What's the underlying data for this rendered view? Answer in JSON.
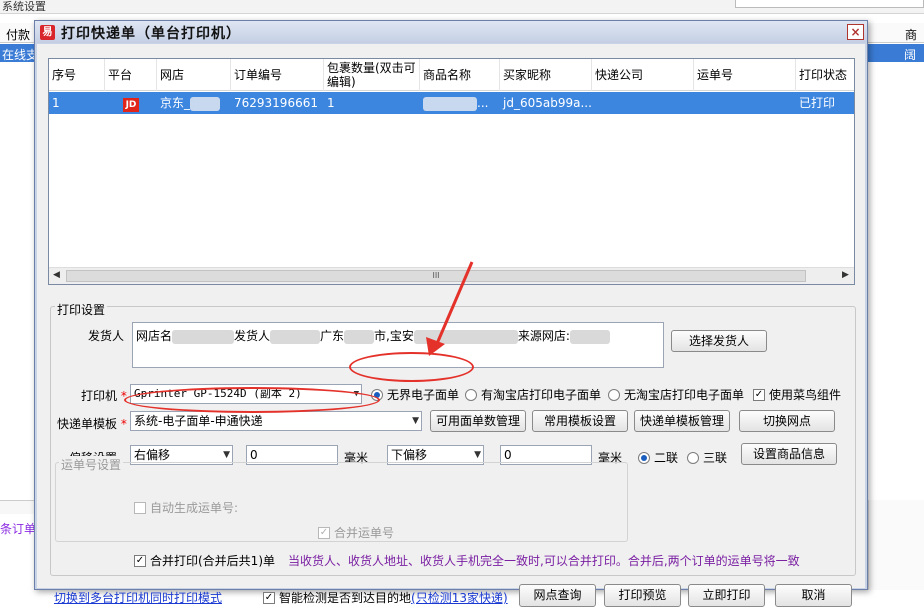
{
  "background": {
    "menu_label": "系统设置",
    "header_left": "付款",
    "header_right": "商",
    "row_left": "在线支",
    "row_right": "阔签",
    "bottom_left_text": "条订单"
  },
  "dialog": {
    "icon_glyph": "易",
    "title": "打印快递单（单台打印机）",
    "close_label": "×"
  },
  "grid": {
    "columns": [
      "序号",
      "平台",
      "网店",
      "订单编号",
      "包裹数量(双击可编辑)",
      "商品名称",
      "买家昵称",
      "快递公司",
      "运单号",
      "打印状态"
    ],
    "row": {
      "index": "1",
      "platform": "JD",
      "shop": "京东_",
      "order_no": "76293196661",
      "packages": "1",
      "product": "...",
      "buyer": "jd_605ab99a...",
      "express": "",
      "waybill": "",
      "status": "已打印"
    },
    "scroll_grip": "III"
  },
  "settings": {
    "group_label": "打印设置",
    "sender_label": "发货人",
    "sender_text": {
      "p1": "网店名",
      "p2": "发货人",
      "p3": "广东",
      "p4": "市,宝安",
      "p5": "来源网店:"
    },
    "select_sender_button": "选择发货人",
    "printer_label": "打印机",
    "required_mark": "*",
    "printer_value": "Gprinter  GP-1524D (副本 2)",
    "radio_options": [
      "无界电子面单",
      "有淘宝店打印电子面单",
      "无淘宝店打印电子面单"
    ],
    "radio_selected": 0,
    "use_cainiao_label": "使用菜鸟组件",
    "use_cainiao_checked": true,
    "template_label": "快递单模板",
    "template_value": "系统-电子面单-申通快递",
    "buttons_row2": [
      "可用面单数管理",
      "常用模板设置",
      "快递单模板管理",
      "切换网点"
    ],
    "offset_label": "偏移设置",
    "offset_h_dir": "右偏移",
    "offset_h_value": "0",
    "offset_h_unit": "毫米",
    "offset_v_dir": "下偏移",
    "offset_v_value": "0",
    "offset_v_unit": "毫米",
    "copies_options": [
      "二联",
      "三联"
    ],
    "copies_selected": 0,
    "set_product_info_button": "设置商品信息",
    "waybill_group_label": "运单号设置",
    "auto_waybill_label": "自动生成运单号:",
    "merge_waybill_label": "合并运单号",
    "merge_print_label": "合并打印(合并后共1)单",
    "merge_hint": "当收货人、收货人地址、收货人手机完全一致时,可以合并打印。合并后,两个订单的运单号将一致"
  },
  "footer": {
    "switch_link": "切换到多台打印机同时打印模式",
    "smart_check_label": "智能检测是否到达目的地",
    "smart_check_link": "(只检测13家快递)",
    "buttons": [
      "网点查询",
      "打印预览",
      "立即打印",
      "取消"
    ]
  },
  "colors": {
    "selection_blue": "#3c86e0",
    "annotation_red": "#e4322b",
    "hint_purple": "#7a1fa2",
    "link_blue": "#1a3ad2"
  }
}
